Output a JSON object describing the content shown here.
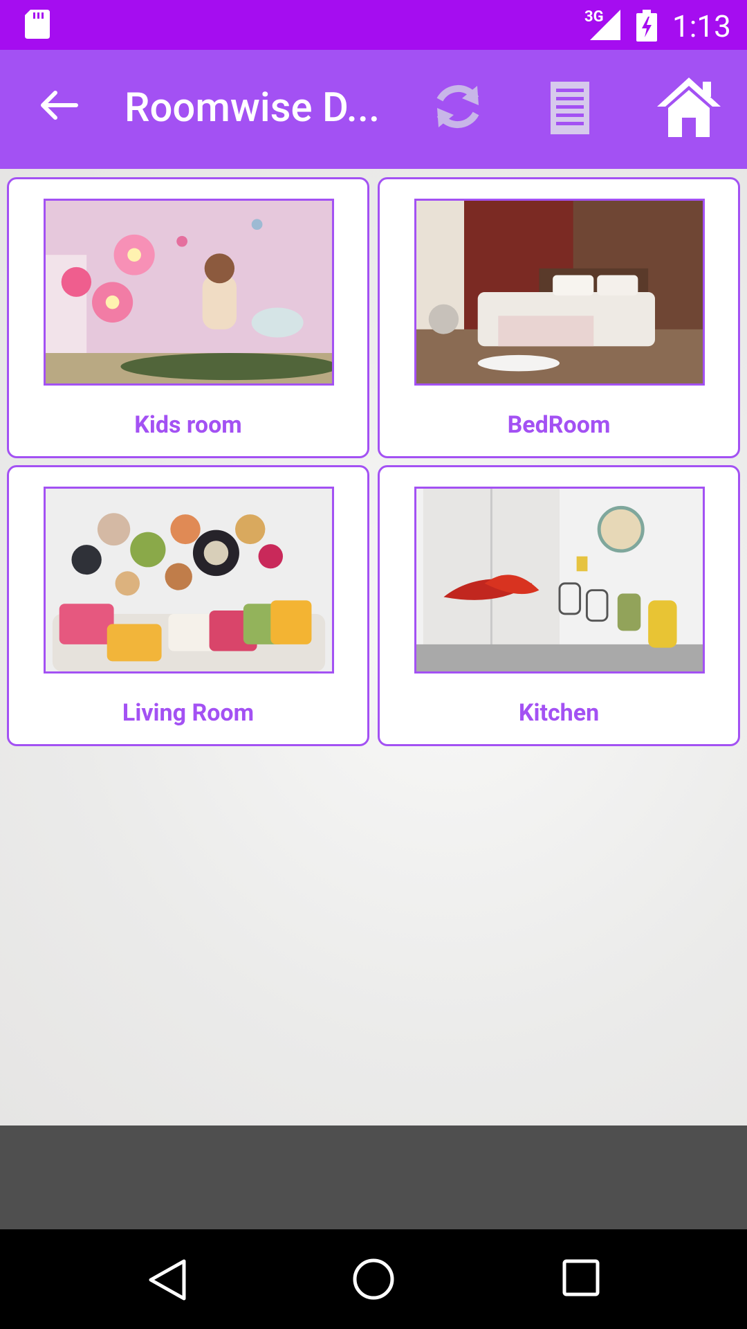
{
  "status_bar": {
    "network_type": "3G",
    "time": "1:13",
    "icons": [
      "sd-card-icon",
      "signal-icon",
      "battery-charging-icon"
    ]
  },
  "app_bar": {
    "title": "Roomwise D...",
    "icons": [
      "back-arrow-icon",
      "refresh-icon",
      "list-icon",
      "home-icon"
    ]
  },
  "categories": [
    {
      "label": "Kids room",
      "image": "kids-room-image"
    },
    {
      "label": "BedRoom",
      "image": "bedroom-image"
    },
    {
      "label": "Living Room",
      "image": "living-room-image"
    },
    {
      "label": "Kitchen",
      "image": "kitchen-image"
    }
  ],
  "nav_bar": {
    "icons": [
      "nav-back-icon",
      "nav-home-icon",
      "nav-recents-icon"
    ]
  },
  "colors": {
    "status_bar": "#a50df0",
    "app_bar": "#a351f3",
    "accent": "#a351f3",
    "ad_area": "#4f4f4f",
    "nav_bar": "#000000"
  }
}
